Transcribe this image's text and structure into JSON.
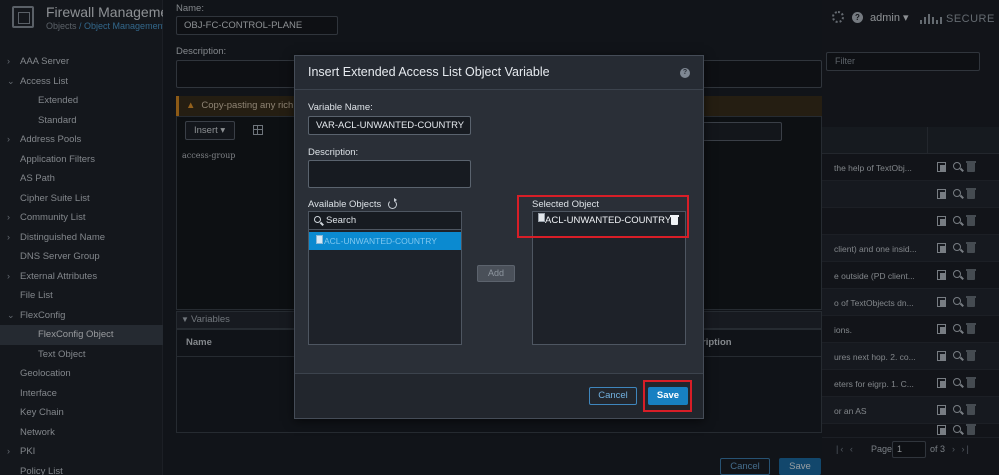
{
  "app": {
    "title": "Firewall Management",
    "breadcrumb_root": "Objects",
    "breadcrumb_separator": " / ",
    "breadcrumb_current": "Object Management"
  },
  "sidebar": {
    "items": [
      {
        "label": "AAA Server",
        "chevron": "›"
      },
      {
        "label": "Access List",
        "chevron": "⌄"
      },
      {
        "label": "Extended",
        "chevron": ""
      },
      {
        "label": "Standard",
        "chevron": ""
      },
      {
        "label": "Address Pools",
        "chevron": "›"
      },
      {
        "label": "Application Filters",
        "chevron": ""
      },
      {
        "label": "AS Path",
        "chevron": ""
      },
      {
        "label": "Cipher Suite List",
        "chevron": ""
      },
      {
        "label": "Community List",
        "chevron": "›"
      },
      {
        "label": "Distinguished Name",
        "chevron": "›"
      },
      {
        "label": "DNS Server Group",
        "chevron": ""
      },
      {
        "label": "External Attributes",
        "chevron": "›"
      },
      {
        "label": "File List",
        "chevron": ""
      },
      {
        "label": "FlexConfig",
        "chevron": "⌄"
      },
      {
        "label": "FlexConfig Object",
        "chevron": ""
      },
      {
        "label": "Text Object",
        "chevron": ""
      },
      {
        "label": "Geolocation",
        "chevron": ""
      },
      {
        "label": "Interface",
        "chevron": ""
      },
      {
        "label": "Key Chain",
        "chevron": ""
      },
      {
        "label": "Network",
        "chevron": ""
      },
      {
        "label": "PKI",
        "chevron": "›"
      },
      {
        "label": "Policy List",
        "chevron": ""
      }
    ]
  },
  "background_form": {
    "name_label": "Name:",
    "name_value": "OBJ-FC-CONTROL-PLANE",
    "description_label": "Description:",
    "warning_text": "Copy-pasting any rich",
    "insert_label": "Insert",
    "code_text": "access-group",
    "variables_label": "Variables",
    "col_name": "Name",
    "col_description": "ription",
    "cancel_label": "Cancel",
    "save_label": "Save"
  },
  "topbar": {
    "user": "admin",
    "brand_text": "SECURE"
  },
  "right_pane": {
    "filter_placeholder": "Filter",
    "rows": [
      "the help of TextObj...",
      "",
      "",
      "client) and one insid...",
      "e outside (PD client...",
      "o of TextObjects dn...",
      "ions.",
      "ures next hop. 2. co...",
      "eters for eigrp. 1. C...",
      "or an AS",
      ""
    ],
    "pager": {
      "page_label": "Page",
      "page_value": "1",
      "of_label": "of 3"
    }
  },
  "modal": {
    "title": "Insert Extended Access List Object Variable",
    "help_glyph": "?",
    "variable_name_label": "Variable Name:",
    "variable_name_value": "VAR-ACL-UNWANTED-COUNTRY",
    "description_label": "Description:",
    "available_label": "Available Objects",
    "search_placeholder": "Search",
    "available_items": [
      "ACL-UNWANTED-COUNTRY"
    ],
    "add_label": "Add",
    "selected_label": "Selected Object",
    "selected_items": [
      "ACL-UNWANTED-COUNTRY"
    ],
    "cancel_label": "Cancel",
    "save_label": "Save"
  },
  "colors": {
    "accent": "#1780c2",
    "highlight_box": "#d81e27",
    "selected_row": "#0b8ad0",
    "warning": "#e3952b"
  }
}
